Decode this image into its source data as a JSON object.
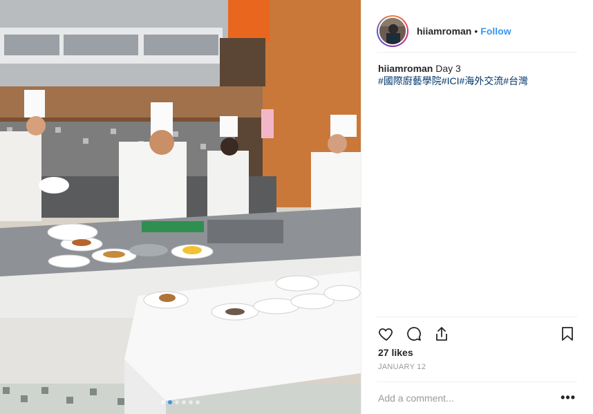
{
  "post": {
    "username": "hiiamroman",
    "separator": "•",
    "follow_label": "Follow",
    "caption_text": "Day 3",
    "hashtags": "#國際廚藝學院#ICI#海外交流#台灣",
    "likes": "27 likes",
    "date": "JANUARY 12",
    "comment_placeholder": "Add a comment...",
    "more_label": "•••"
  },
  "carousel": {
    "count": 6,
    "active": 2
  },
  "icons": {
    "like": "heart-icon",
    "comment": "comment-bubble-icon",
    "share": "share-upload-icon",
    "save": "bookmark-icon",
    "more": "more-options-icon"
  },
  "colors": {
    "link": "#3897f0",
    "hashtag": "#003569",
    "muted": "#999999",
    "text": "#262626"
  }
}
